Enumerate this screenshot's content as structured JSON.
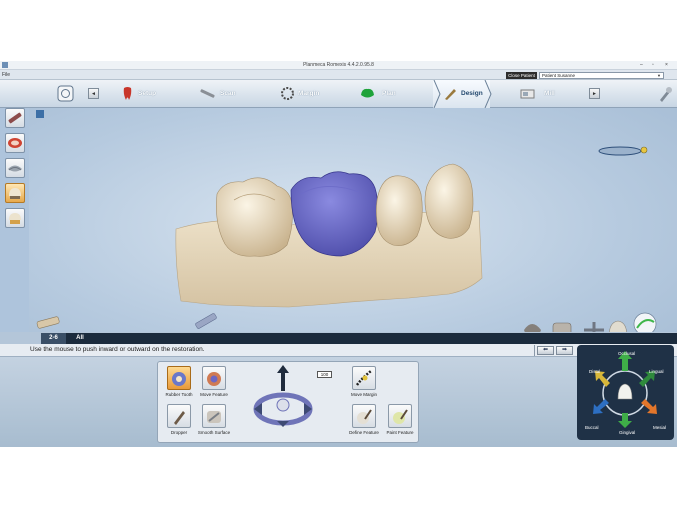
{
  "window": {
    "title": "Planmeca Romexis 4.4.2.0.95.8",
    "controls": [
      "–",
      "▫",
      "×"
    ]
  },
  "menu": {
    "file_label": "File"
  },
  "patient": {
    "close_label": "Close Patient",
    "name": "Patient Susanne"
  },
  "workflow": {
    "steps": [
      {
        "label": "Setup"
      },
      {
        "label": "Scan"
      },
      {
        "label": "Margin"
      },
      {
        "label": "Plan"
      },
      {
        "label": "Design"
      },
      {
        "label": "Mill"
      }
    ],
    "active": "Design",
    "nav_prev": "◄",
    "nav_next": "►"
  },
  "tabs": {
    "tooth_tab": "2-6",
    "all_tab": "All"
  },
  "instruction": "Use the mouse to push inward or outward on the restoration.",
  "undo_label": "⬅",
  "redo_label": "➡",
  "tools": {
    "rubber_tooth": "Rubber Tooth",
    "move_feature": "Move Feature",
    "dropper": "Dropper",
    "smooth_surface": "Smooth Surface",
    "move_margin": "Move Margin",
    "define_feature": "Define Feature",
    "paint_feature": "Paint Feature",
    "zoom_value": "100"
  },
  "orientation": {
    "occlusal": "Occlusal",
    "lingual": "Lingual",
    "distal": "Distal",
    "mesial": "Mesial",
    "buccal": "Buccal",
    "gingival": "Gingival"
  },
  "colors": {
    "restoration": "#5d5cb8",
    "dentition": "#e8dcc4",
    "viewport": "#b6cadf",
    "toolbar_dark": "#1b2b3d"
  }
}
